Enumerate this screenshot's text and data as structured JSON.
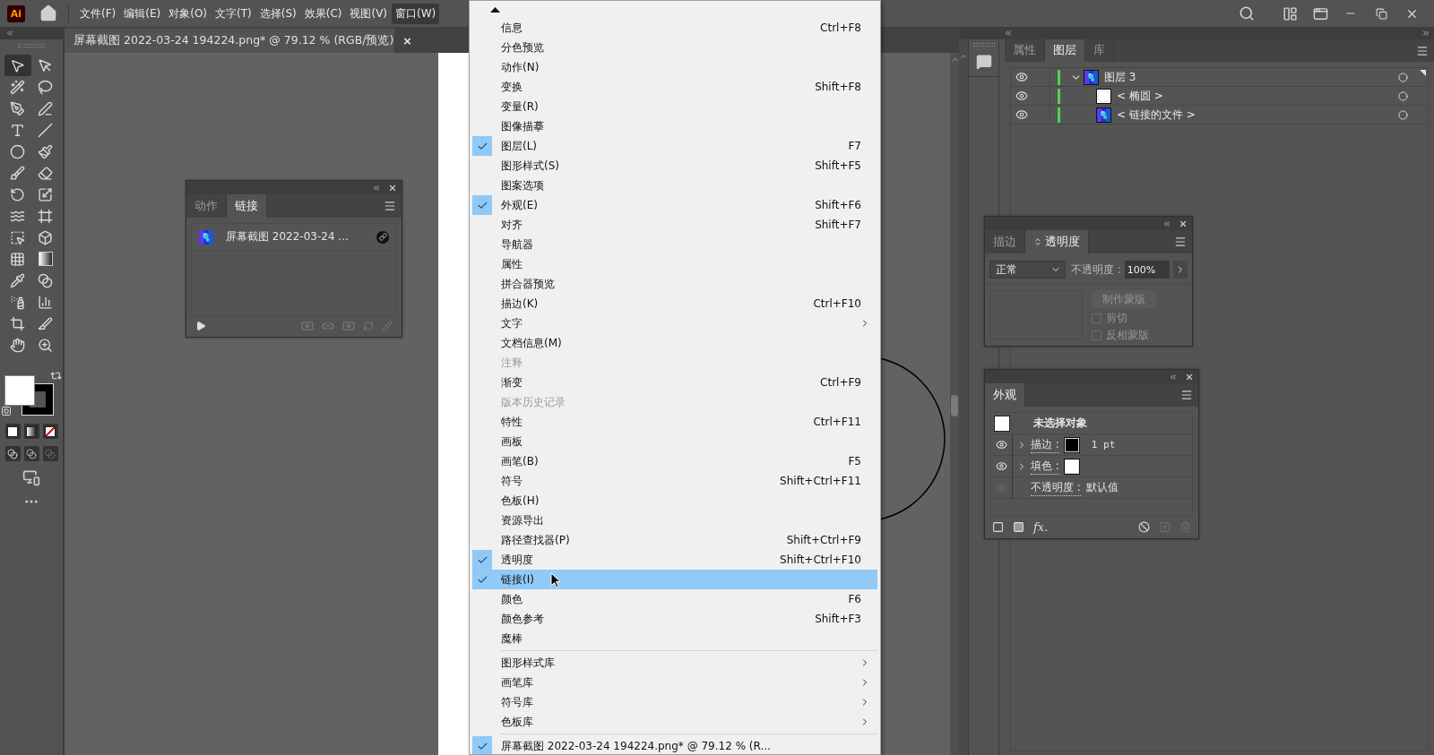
{
  "app_logo": "Ai",
  "menubar": {
    "items": [
      {
        "label": "文件(F)",
        "selected": false
      },
      {
        "label": "编辑(E)",
        "selected": false
      },
      {
        "label": "对象(O)",
        "selected": false
      },
      {
        "label": "文字(T)",
        "selected": false
      },
      {
        "label": "选择(S)",
        "selected": false
      },
      {
        "label": "效果(C)",
        "selected": false
      },
      {
        "label": "视图(V)",
        "selected": false
      },
      {
        "label": "窗口(W)",
        "selected": true
      }
    ]
  },
  "document_tab": {
    "title": "屏幕截图 2022-03-24 194224.png* @ 79.12 % (RGB/预览)",
    "close": "×"
  },
  "links_panel": {
    "tabs": [
      {
        "label": "动作",
        "selected": false
      },
      {
        "label": "链接",
        "selected": true
      }
    ],
    "links": [
      {
        "name": "屏幕截图 2022-03-24 ..."
      }
    ]
  },
  "window_menu": {
    "groups": [
      [
        {
          "label": "信息",
          "shortcut": "Ctrl+F8",
          "kind": "command",
          "checked": false,
          "disabled": false,
          "selected": false
        },
        {
          "label": "分色预览",
          "kind": "command",
          "checked": false,
          "disabled": false,
          "selected": false
        },
        {
          "label": "动作(N)",
          "kind": "command",
          "checked": false,
          "disabled": false,
          "selected": false
        },
        {
          "label": "变换",
          "shortcut": "Shift+F8",
          "kind": "command",
          "checked": false,
          "disabled": false,
          "selected": false
        },
        {
          "label": "变量(R)",
          "kind": "command",
          "checked": false,
          "disabled": false,
          "selected": false
        },
        {
          "label": "图像描摹",
          "kind": "command",
          "checked": false,
          "disabled": false,
          "selected": false
        },
        {
          "label": "图层(L)",
          "shortcut": "F7",
          "kind": "command",
          "checked": true,
          "disabled": false,
          "selected": false
        },
        {
          "label": "图形样式(S)",
          "shortcut": "Shift+F5",
          "kind": "command",
          "checked": false,
          "disabled": false,
          "selected": false
        },
        {
          "label": "图案选项",
          "kind": "command",
          "checked": false,
          "disabled": false,
          "selected": false
        },
        {
          "label": "外观(E)",
          "shortcut": "Shift+F6",
          "kind": "command",
          "checked": true,
          "disabled": false,
          "selected": false
        },
        {
          "label": "对齐",
          "shortcut": "Shift+F7",
          "kind": "command",
          "checked": false,
          "disabled": false,
          "selected": false
        },
        {
          "label": "导航器",
          "kind": "command",
          "checked": false,
          "disabled": false,
          "selected": false
        },
        {
          "label": "属性",
          "kind": "command",
          "checked": false,
          "disabled": false,
          "selected": false
        },
        {
          "label": "拼合器预览",
          "kind": "command",
          "checked": false,
          "disabled": false,
          "selected": false
        },
        {
          "label": "描边(K)",
          "shortcut": "Ctrl+F10",
          "kind": "command",
          "checked": false,
          "disabled": false,
          "selected": false
        },
        {
          "label": "文字",
          "kind": "submenu",
          "checked": false,
          "disabled": false,
          "selected": false
        },
        {
          "label": "文档信息(M)",
          "kind": "command",
          "checked": false,
          "disabled": false,
          "selected": false
        },
        {
          "label": "注释",
          "kind": "command",
          "checked": false,
          "disabled": true,
          "selected": false
        },
        {
          "label": "渐变",
          "shortcut": "Ctrl+F9",
          "kind": "command",
          "checked": false,
          "disabled": false,
          "selected": false
        },
        {
          "label": "版本历史记录",
          "kind": "command",
          "checked": false,
          "disabled": true,
          "selected": false
        },
        {
          "label": "特性",
          "shortcut": "Ctrl+F11",
          "kind": "command",
          "checked": false,
          "disabled": false,
          "selected": false
        },
        {
          "label": "画板",
          "kind": "command",
          "checked": false,
          "disabled": false,
          "selected": false
        },
        {
          "label": "画笔(B)",
          "shortcut": "F5",
          "kind": "command",
          "checked": false,
          "disabled": false,
          "selected": false
        },
        {
          "label": "符号",
          "shortcut": "Shift+Ctrl+F11",
          "kind": "command",
          "checked": false,
          "disabled": false,
          "selected": false
        },
        {
          "label": "色板(H)",
          "kind": "command",
          "checked": false,
          "disabled": false,
          "selected": false
        },
        {
          "label": "资源导出",
          "kind": "command",
          "checked": false,
          "disabled": false,
          "selected": false
        },
        {
          "label": "路径查找器(P)",
          "shortcut": "Shift+Ctrl+F9",
          "kind": "command",
          "checked": false,
          "disabled": false,
          "selected": false
        },
        {
          "label": "透明度",
          "shortcut": "Shift+Ctrl+F10",
          "kind": "command",
          "checked": true,
          "disabled": false,
          "selected": false
        },
        {
          "label": "链接(I)",
          "kind": "command",
          "checked": true,
          "disabled": false,
          "selected": true
        },
        {
          "label": "颜色",
          "shortcut": "F6",
          "kind": "command",
          "checked": false,
          "disabled": false,
          "selected": false
        },
        {
          "label": "颜色参考",
          "shortcut": "Shift+F3",
          "kind": "command",
          "checked": false,
          "disabled": false,
          "selected": false
        },
        {
          "label": "魔棒",
          "kind": "command",
          "checked": false,
          "disabled": false,
          "selected": false
        }
      ],
      [
        {
          "label": "图形样式库",
          "kind": "submenu",
          "checked": false,
          "disabled": false,
          "selected": false
        },
        {
          "label": "画笔库",
          "kind": "submenu",
          "checked": false,
          "disabled": false,
          "selected": false
        },
        {
          "label": "符号库",
          "kind": "submenu",
          "checked": false,
          "disabled": false,
          "selected": false
        },
        {
          "label": "色板库",
          "kind": "submenu",
          "checked": false,
          "disabled": false,
          "selected": false
        }
      ],
      [
        {
          "label": "屏幕截图 2022-03-24 194224.png* @ 79.12 % (R...",
          "kind": "command",
          "checked": true,
          "disabled": false,
          "selected": false
        }
      ]
    ]
  },
  "layers_panel": {
    "tabs": [
      {
        "label": "属性",
        "selected": false
      },
      {
        "label": "图层",
        "selected": true
      },
      {
        "label": "库",
        "selected": false
      }
    ],
    "layers": [
      {
        "name": "图层 3",
        "visible": true,
        "expanded": true,
        "color": "#4ed44e",
        "kind": "picture",
        "children": [
          {
            "name": "< 椭圆 >",
            "visible": true,
            "color": "#4ed44e",
            "kind": "ellipse"
          },
          {
            "name": "< 链接的文件 >",
            "visible": true,
            "color": "#4ed44e",
            "kind": "picture"
          }
        ]
      }
    ]
  },
  "transparency_panel": {
    "tabs": [
      {
        "label": "描边",
        "selected": false
      },
      {
        "label": "透明度",
        "selected": true
      }
    ],
    "blend_mode": "正常",
    "opacity_label": "不透明度 :",
    "opacity_value": "100%",
    "make_mask_button": {
      "label": "制作蒙版",
      "disabled": true
    },
    "options": [
      {
        "label": "剪切",
        "checked": false,
        "disabled": true
      },
      {
        "label": "反相蒙版",
        "checked": false,
        "disabled": true
      }
    ]
  },
  "appearance_panel": {
    "tabs": [
      {
        "label": "外观",
        "selected": true
      }
    ],
    "header": "未选择对象",
    "rows": [
      {
        "kind": "stroke",
        "label": "描边 :",
        "visible": true,
        "color": "#000000",
        "value": "1 pt"
      },
      {
        "kind": "fill",
        "label": "填色 :",
        "visible": true,
        "color": "#ffffff"
      },
      {
        "kind": "opacity",
        "label": "不透明度 :",
        "visible": false,
        "value": "默认值"
      }
    ],
    "footer_label": "fx."
  }
}
